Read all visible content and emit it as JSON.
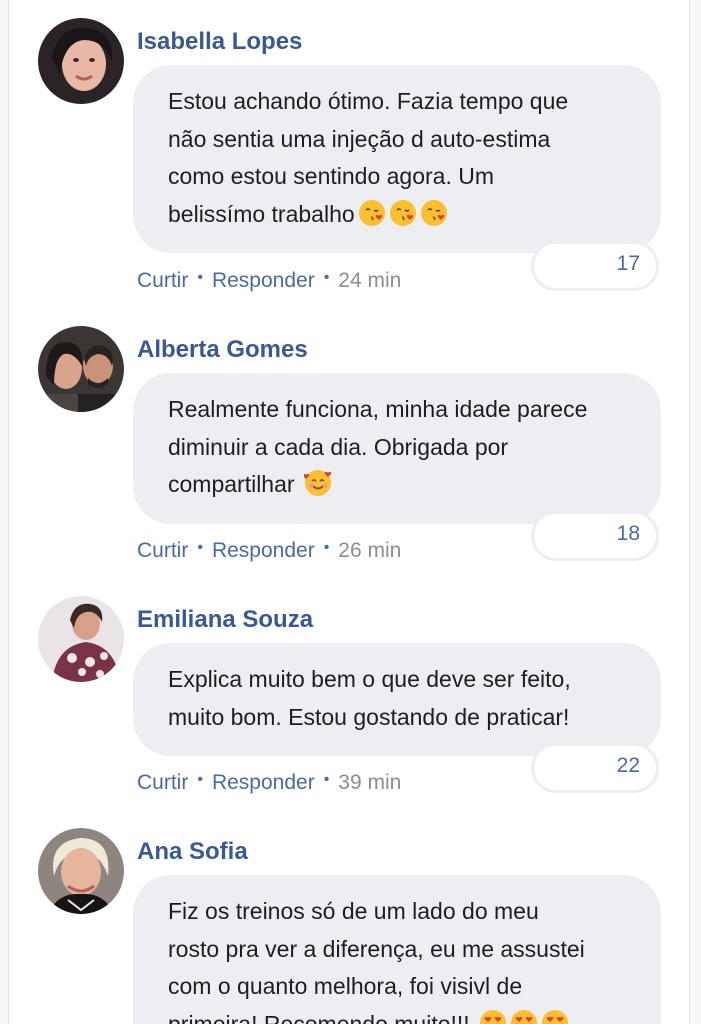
{
  "comments": [
    {
      "author": "Isabella Lopes",
      "text_lines": [
        "Estou achando ótimo. Fazia tempo que",
        "não sentia uma injeção d auto-estima",
        "como estou sentindo agora. Um",
        "belissímo trabalho"
      ],
      "emoji": "😘😘😘",
      "like_label": "Curtir",
      "reply_label": "Responder",
      "time": "24 min",
      "reaction_count": "17"
    },
    {
      "author": "Alberta Gomes",
      "text_lines": [
        "Realmente funciona, minha idade parece",
        "diminuir a cada dia. Obrigada por",
        "compartilhar"
      ],
      "emoji": "🥰",
      "like_label": "Curtir",
      "reply_label": "Responder",
      "time": "26 min",
      "reaction_count": "18"
    },
    {
      "author": "Emiliana Souza",
      "text_lines": [
        "Explica muito bem o que deve ser feito,",
        "muito bom. Estou gostando de praticar!"
      ],
      "like_label": "Curtir",
      "reply_label": "Responder",
      "time": "39 min",
      "reaction_count": "22"
    },
    {
      "author": "Ana Sofia",
      "text_lines": [
        "Fiz os treinos só de um lado do meu",
        "rosto pra ver a diferença, eu me assustei",
        "com o quanto melhora, foi visivl de",
        "primeira! Recomendo muito!!!"
      ],
      "emoji": "😍😍😍"
    }
  ],
  "colors": {
    "author_name": "#385898",
    "action_link": "#4b69a8",
    "timestamp": "#8a8d91",
    "bubble_bg": "#edeef1",
    "page_bg": "#f7f8fa"
  }
}
